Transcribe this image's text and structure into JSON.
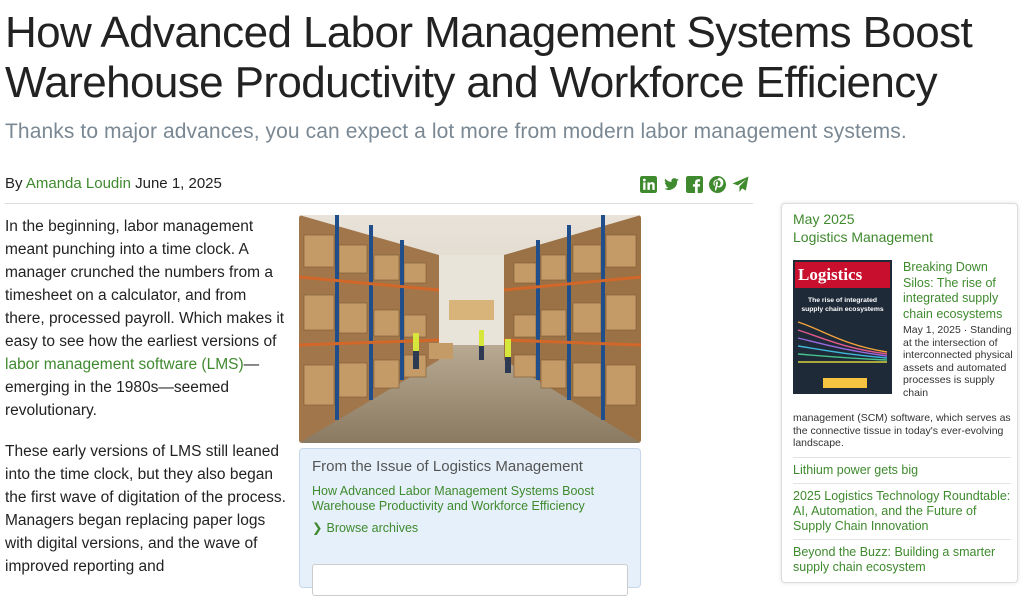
{
  "article": {
    "title": "How Advanced Labor Management Systems Boost Warehouse Productivity and Workforce Efficiency",
    "subtitle": "Thanks to major advances, you can expect a lot more from modern labor management systems.",
    "by_label": "By",
    "author": "Amanda Loudin",
    "date": "June 1, 2025",
    "share_icons": [
      "linkedin-icon",
      "twitter-icon",
      "facebook-icon",
      "pinterest-icon",
      "send-icon"
    ],
    "p1_before": "In the beginning, labor management meant punching into a time clock. A manager crunched the numbers from a timesheet on a calculator, and from there, processed payroll. Which makes it easy to see how the earliest versions of ",
    "p1_link": "labor management software (LMS)",
    "p1_after": "—emerging in the 1980s—seemed revolutionary.",
    "p2": "These early versions of LMS still leaned into the time clock, but they also began the first wave of digitation of the process. Managers began replacing paper logs with digital versions, and the wave of improved reporting and"
  },
  "issue_box": {
    "heading": "From the Issue of Logistics Management",
    "link": "How Advanced Labor Management Systems Boost Warehouse Productivity and Workforce Efficiency",
    "browse": "Browse archives"
  },
  "sidebar": {
    "issue_month": "May 2025",
    "magazine": "Logistics Management",
    "cover_title": "Logistics",
    "cover_subtitle": "The rise of integrated supply chain ecosystems",
    "feature_title": "Breaking Down Silos: The rise of integrated supply chain ecosystems",
    "feature_date": "May 1, 2025 ·",
    "feature_desc_a": "Standing at the intersection of interconnected physical assets and automated processes is supply chain",
    "feature_desc_b": "management (SCM) software, which serves as the connective tissue in today's ever-evolving landscape.",
    "items": [
      "Lithium power gets big",
      "2025 Logistics Technology Roundtable: AI, Automation, and the Future of Supply Chain Innovation",
      "Beyond the Buzz: Building a smarter supply chain ecosystem"
    ]
  },
  "colors": {
    "link_green": "#3f8a2e",
    "subtitle_gray": "#7a8893",
    "issue_bg": "#e5f0fa"
  }
}
